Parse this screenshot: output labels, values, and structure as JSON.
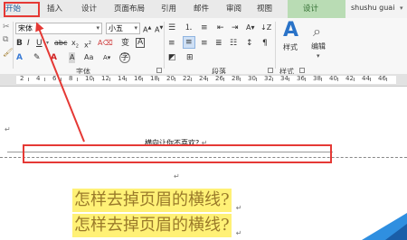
{
  "tabs": {
    "home": "开始",
    "insert": "插入",
    "design": "设计",
    "layout": "页面布局",
    "references": "引用",
    "mailings": "邮件",
    "review": "审阅",
    "view": "视图",
    "design_context": "设计",
    "user": "shushu guai"
  },
  "ribbon": {
    "font_name": "宋体",
    "font_size": "小五",
    "group_font": "字体",
    "group_paragraph": "段落",
    "group_style": "样式",
    "style_label": "样式",
    "edit_label": "编辑"
  },
  "ruler": {
    "numbers": [
      "2",
      "4",
      "6",
      "8",
      "10",
      "12",
      "14",
      "16",
      "18",
      "20",
      "22",
      "24",
      "26",
      "28",
      "30",
      "32",
      "34",
      "36",
      "38",
      "40",
      "42",
      "44",
      "46"
    ]
  },
  "document": {
    "header_text": "横向让你不喜欢?",
    "paragraph_mark": "↵",
    "lines": [
      "怎样去掉页眉的横线?",
      "怎样去掉页眉的横线?"
    ]
  },
  "colors": {
    "annotation_red": "#e53935",
    "highlight": "#fff176",
    "accent_blue": "#2a73c8",
    "design_tab_green": "#b9dcb4"
  }
}
